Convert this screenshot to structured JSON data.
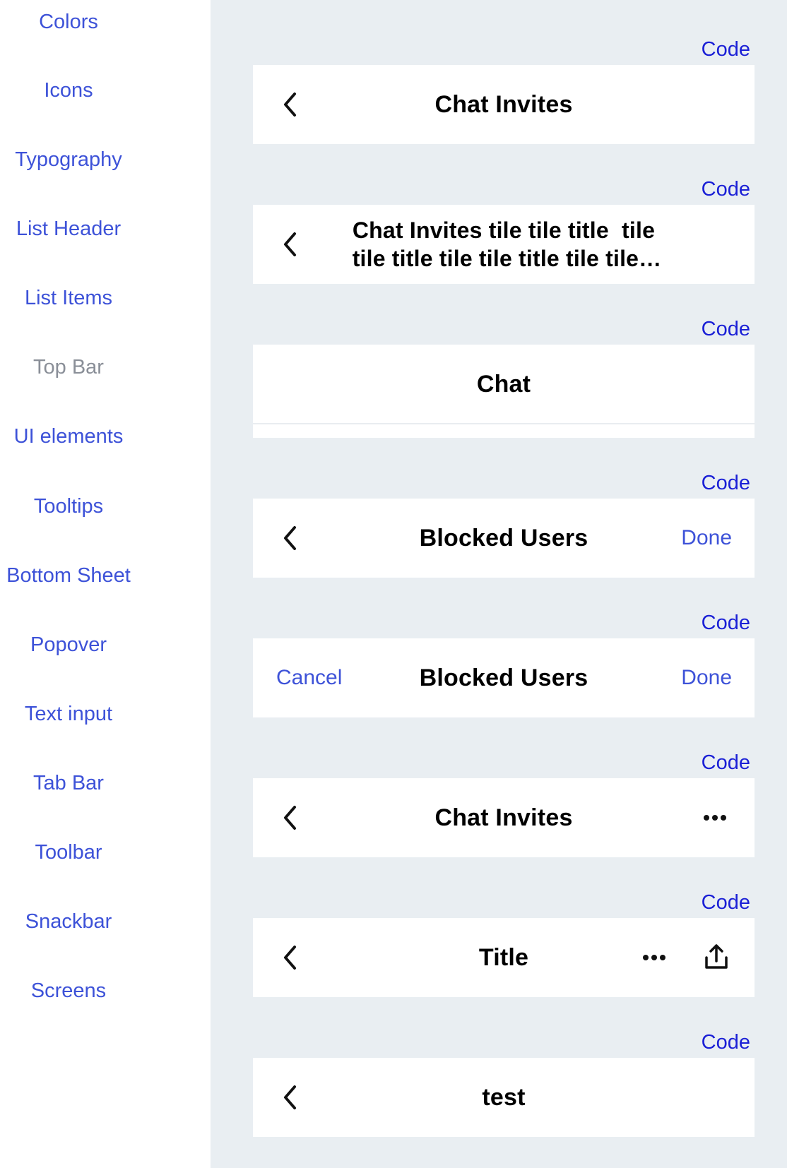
{
  "sidebar": {
    "items": [
      {
        "label": "Colors"
      },
      {
        "label": "Icons"
      },
      {
        "label": "Typography"
      },
      {
        "label": "List Header"
      },
      {
        "label": "List Items"
      },
      {
        "label": "Top Bar"
      },
      {
        "label": "UI elements"
      },
      {
        "label": "Tooltips"
      },
      {
        "label": "Bottom Sheet"
      },
      {
        "label": "Popover"
      },
      {
        "label": "Text input"
      },
      {
        "label": "Tab Bar"
      },
      {
        "label": "Toolbar"
      },
      {
        "label": "Snackbar"
      },
      {
        "label": "Screens"
      }
    ],
    "active_item": "Top Bar"
  },
  "code_label": "Code",
  "examples": [
    {
      "title": "Chat Invites",
      "left_icon": "chevron-left-icon"
    },
    {
      "title": "Chat Invites tile tile title  tile\n tile title tile tile title tile tile…",
      "left_icon": "chevron-left-icon"
    },
    {
      "title": "Chat"
    },
    {
      "title": "Blocked Users",
      "left_icon": "chevron-left-icon",
      "right_action": "Done"
    },
    {
      "title": "Blocked Users",
      "left_action": "Cancel",
      "right_action": "Done"
    },
    {
      "title": "Chat Invites",
      "left_icon": "chevron-left-icon",
      "right_icon": "more-horizontal-icon"
    },
    {
      "title": "Title",
      "left_icon": "chevron-left-icon",
      "right_icons": [
        "more-horizontal-icon",
        "share-icon"
      ]
    },
    {
      "title": "test",
      "left_icon": "chevron-left-icon"
    }
  ],
  "colors": {
    "link": "#3d52d8",
    "code_link": "#1a1fd6",
    "inactive": "#8a8f98",
    "canvas": "#e9eef2"
  }
}
